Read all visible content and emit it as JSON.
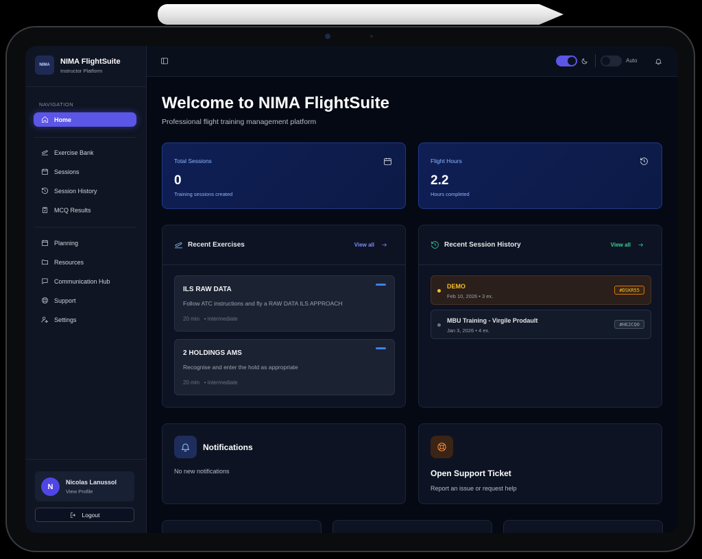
{
  "brand": {
    "logo_text": "NIMA",
    "title": "NIMA FlightSuite",
    "subtitle": "Instructor Platform"
  },
  "nav": {
    "header": "NAVIGATION",
    "home": "Home",
    "group1": [
      "Exercise Bank",
      "Sessions",
      "Session History",
      "MCQ Results"
    ],
    "group2": [
      "Planning",
      "Resources",
      "Communication Hub",
      "Support",
      "Settings"
    ]
  },
  "user": {
    "initial": "N",
    "name": "Nicolas Lanussol",
    "link": "View Profile",
    "logout": "Logout"
  },
  "topbar": {
    "auto_label": "Auto",
    "dark_mode_on": true,
    "auto_on": false
  },
  "page": {
    "title": "Welcome to NIMA FlightSuite",
    "subtitle": "Professional flight training management platform"
  },
  "stats": [
    {
      "label": "Total Sessions",
      "value": "0",
      "desc": "Training sessions created",
      "icon": "calendar-icon"
    },
    {
      "label": "Flight Hours",
      "value": "2.2",
      "desc": "Hours completed",
      "icon": "history-icon"
    }
  ],
  "recent_exercises": {
    "title": "Recent Exercises",
    "view_all": "View all",
    "items": [
      {
        "title": "ILS RAW DATA",
        "desc": "Follow ATC instructions and fly a RAW DATA ILS APPROACH",
        "duration": "20 min",
        "level": "• intermediate"
      },
      {
        "title": "2 HOLDINGS AMS",
        "desc": "Recognise and enter the hold as appropriate",
        "duration": "20 min",
        "level": "• intermediate"
      }
    ]
  },
  "recent_sessions": {
    "title": "Recent Session History",
    "view_all": "View all",
    "items": [
      {
        "name": "DEMO",
        "date": "Feb 10, 2026",
        "count": "• 3 ex.",
        "code": "#DSKR55",
        "highlight": true
      },
      {
        "name": "MBU Training - Virgile Prodault",
        "date": "Jan 3, 2026",
        "count": "• 4 ex.",
        "code": "#HE2CQ0",
        "highlight": false
      }
    ]
  },
  "notifications": {
    "title": "Notifications",
    "empty": "No new notifications"
  },
  "support": {
    "title": "Open Support Ticket",
    "desc": "Report an issue or request help"
  },
  "colors": {
    "accent": "#5b56e6",
    "stat_blue": "#8fb4ff",
    "session_orange": "#fbbf24",
    "history_green": "#34d399"
  }
}
